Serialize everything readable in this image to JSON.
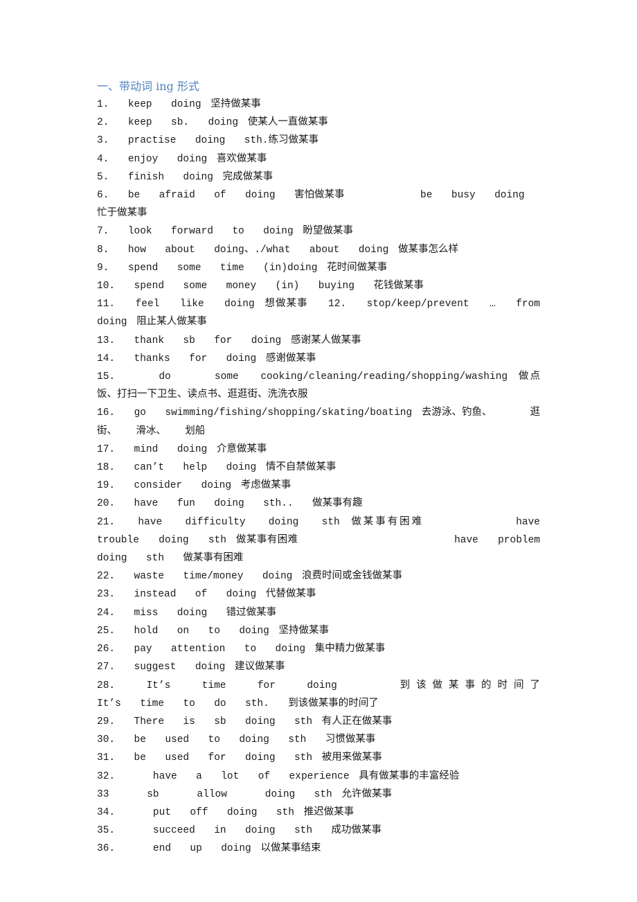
{
  "section_title": "一、带动词 ing 形式",
  "items": [
    {
      "num": "1.",
      "text": "keep  doing 坚持做某事"
    },
    {
      "num": "2.",
      "text": "keep  sb.  doing 使某人一直做某事"
    },
    {
      "num": "3.",
      "text": "practise  doing  sth.练习做某事"
    },
    {
      "num": "4.",
      "text": "enjoy  doing 喜欢做某事"
    },
    {
      "num": "5.",
      "text": "finish  doing 完成做某事"
    },
    {
      "num": "6.",
      "text": "be  afraid  of  doing  害怕做某事        be  busy  doing  忙于做某事"
    },
    {
      "num": "7.",
      "text": "look  forward  to  doing 盼望做某事"
    },
    {
      "num": "8.",
      "text": "how  about  doing、./what  about  doing 做某事怎么样"
    },
    {
      "num": "9.",
      "text": "spend  some  time  (in)doing 花时间做某事"
    },
    {
      "num": "10.",
      "text": "spend  some  money  (in)  buying  花钱做某事"
    },
    {
      "num": "11.",
      "text": "feel  like  doing 想做某事  12.  stop/keep/prevent  …  from  doing 阻止某人做某事"
    },
    {
      "num": "13.",
      "text": "thank  sb  for  doing 感谢某人做某事"
    },
    {
      "num": "14.",
      "text": "thanks  for  doing 感谢做某事"
    },
    {
      "num": "15.",
      "text": "  do    some  cooking/cleaning/reading/shopping/washing 做点饭、打扫一下卫生、读点书、逛逛街、洗洗衣服"
    },
    {
      "num": "16.",
      "text": "go  swimming/fishing/shopping/skating/boating 去游泳、钓鱼、    逛街、  滑冰、  划船"
    },
    {
      "num": "17.",
      "text": "mind  doing 介意做某事"
    },
    {
      "num": "18.",
      "text": "can’t  help  doing 情不自禁做某事"
    },
    {
      "num": "19.",
      "text": "consider  doing 考虑做某事"
    },
    {
      "num": "20.",
      "text": "have  fun  doing  sth..  做某事有趣"
    },
    {
      "num": "21.",
      "text": "have  difficulty  doing  sth 做某事有困难        have  trouble  doing  sth 做某事有困难                have  problem  doing  sth  做某事有困难"
    },
    {
      "num": "22.",
      "text": "waste  time/money  doing 浪费时间或金钱做某事"
    },
    {
      "num": "23.",
      "text": "instead  of  doing 代替做某事"
    },
    {
      "num": "24.",
      "text": "miss  doing  错过做某事"
    },
    {
      "num": "25.",
      "text": "hold  on  to  doing 坚持做某事"
    },
    {
      "num": "26.",
      "text": "pay  attention  to  doing 集中精力做某事"
    },
    {
      "num": "27.",
      "text": "suggest  doing 建议做某事"
    },
    {
      "num": "28.",
      "text": "It’s  time  for  doing    到该做某事的时间了                  It’s  time  to  do  sth.  到该做某事的时间了"
    },
    {
      "num": "29.",
      "text": "There  is  sb  doing  sth 有人正在做某事"
    },
    {
      "num": "30.",
      "text": "be  used  to  doing  sth  习惯做某事"
    },
    {
      "num": "31.",
      "text": "be  used  for  doing  sth 被用来做某事"
    },
    {
      "num": "32.",
      "text": "  have  a  lot  of  experience 具有做某事的丰富经验"
    },
    {
      "num": "33",
      "text": "  sb    allow    doing  sth 允许做某事"
    },
    {
      "num": "34.",
      "text": "  put  off  doing  sth 推迟做某事"
    },
    {
      "num": "35.",
      "text": "  succeed  in  doing  sth  成功做某事"
    },
    {
      "num": "36.",
      "text": "  end  up  doing 以做某事结束"
    }
  ]
}
